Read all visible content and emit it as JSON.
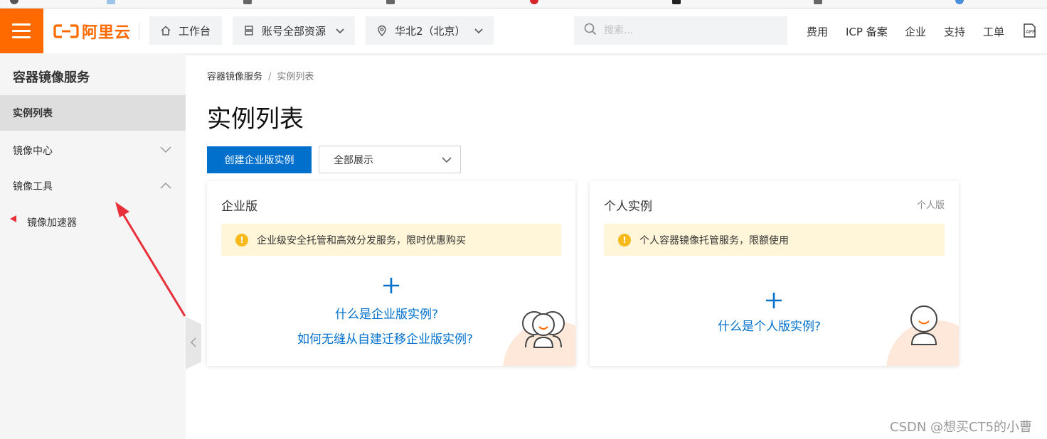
{
  "topbar": {
    "logo_text": "阿里云",
    "workbench_label": "工作台",
    "resources_label": "账号全部资源",
    "region_label": "华北2（北京）",
    "search_placeholder": "搜索...",
    "links": [
      "费用",
      "ICP 备案",
      "企业",
      "支持",
      "工单"
    ]
  },
  "sidebar": {
    "title": "容器镜像服务",
    "items": [
      {
        "label": "实例列表"
      },
      {
        "label": "镜像中心"
      },
      {
        "label": "镜像工具"
      }
    ],
    "sub_item": "镜像加速器"
  },
  "breadcrumb": {
    "root": "容器镜像服务",
    "sep": "/",
    "current": "实例列表"
  },
  "page": {
    "title": "实例列表",
    "create_button": "创建企业版实例",
    "filter_value": "全部展示"
  },
  "cards": {
    "enterprise": {
      "title": "企业版",
      "notice": "企业级安全托管和高效分发服务，限时优惠购买",
      "link1": "什么是企业版实例?",
      "link2": "如何无缝从自建迁移企业版实例?"
    },
    "personal": {
      "title": "个人实例",
      "tag": "个人版",
      "notice": "个人容器镜像托管服务，限额使用",
      "link1": "什么是个人版实例?"
    }
  },
  "watermark": "CSDN @想买CT5的小曹",
  "colors": {
    "brand": "#ff6a00",
    "primary": "#0070cc",
    "notice_bg": "#fff5d8",
    "annotation_arrow": "#e8303b"
  }
}
